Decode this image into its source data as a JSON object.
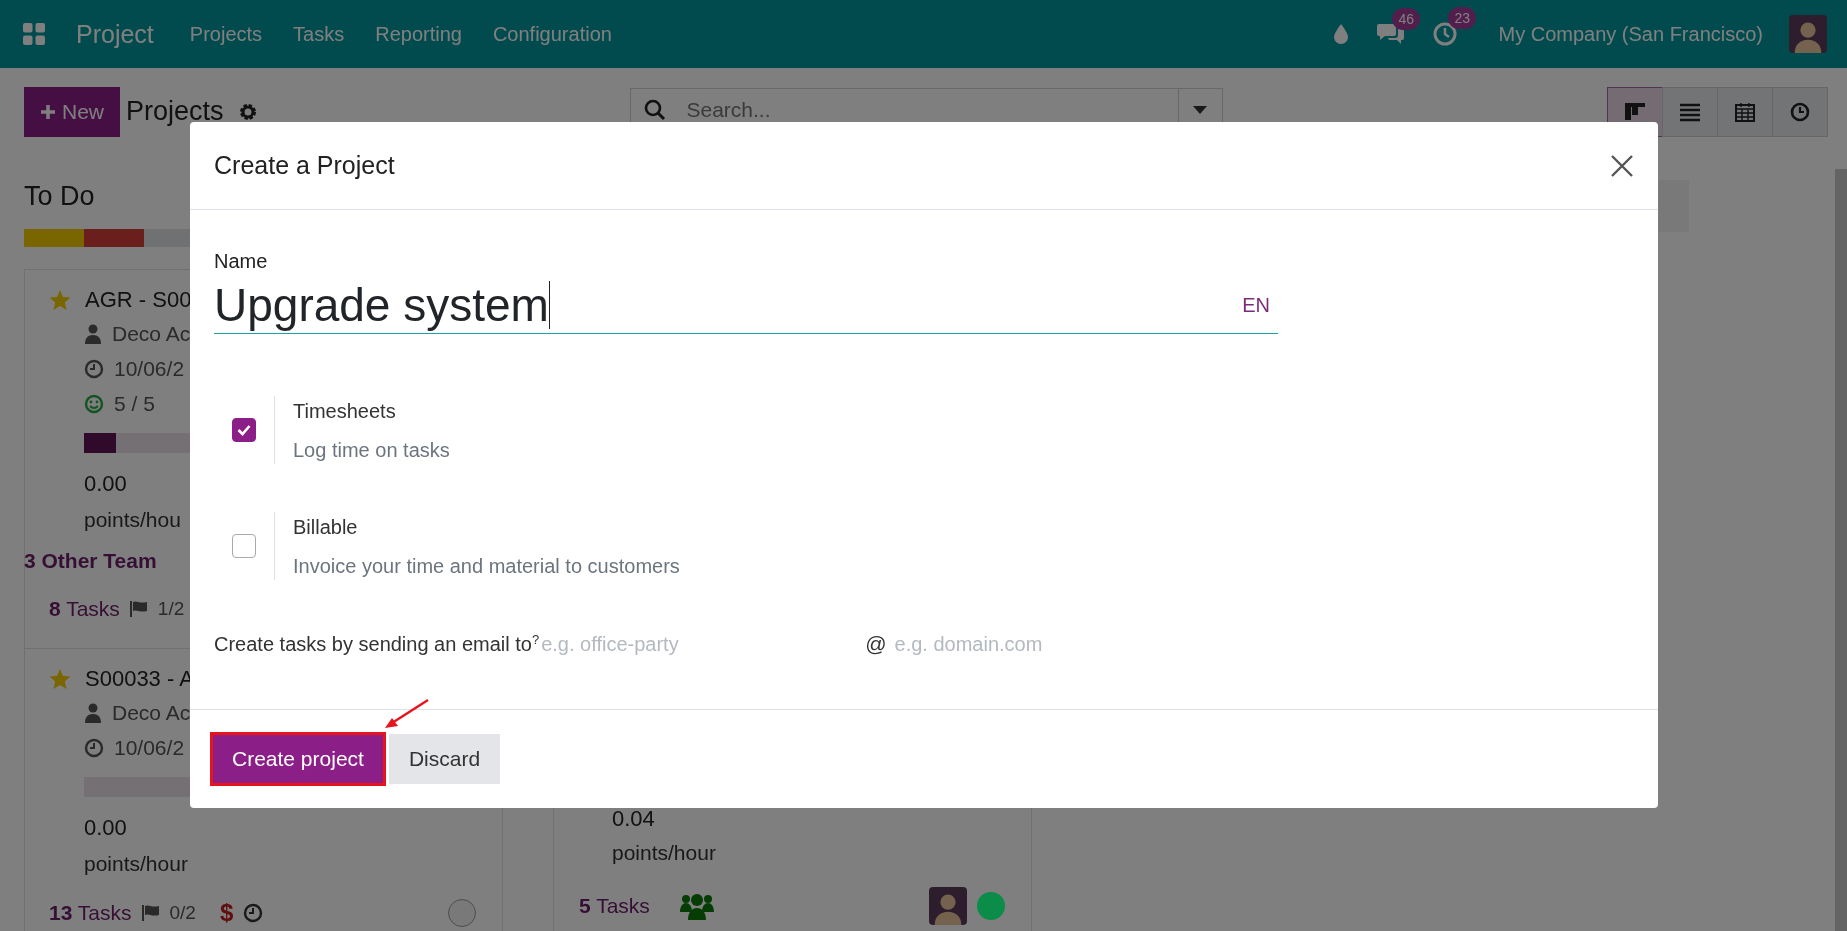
{
  "navbar": {
    "app_name": "Project",
    "menu": [
      "Projects",
      "Tasks",
      "Reporting",
      "Configuration"
    ],
    "messages_badge": "46",
    "activities_badge": "23",
    "company": "My Company (San Francisco)"
  },
  "control_panel": {
    "new_button": "New",
    "title": "Projects",
    "search": {
      "placeholder": "Search..."
    },
    "views": [
      {
        "kind": "kanban",
        "selected": true
      },
      {
        "kind": "list",
        "selected": false
      },
      {
        "kind": "calendar",
        "selected": false
      },
      {
        "kind": "activity",
        "selected": false
      }
    ]
  },
  "columns": [
    {
      "title": "To Do",
      "progress": [
        {
          "color": "#7a6600"
        },
        {
          "color": "#6b1f1d"
        },
        {
          "color": "#6f7173"
        }
      ],
      "cards": [
        {
          "kind": "full",
          "title": "AGR - S00",
          "starred": true,
          "customer": "Deco Ac",
          "date": "10/06/2",
          "rating": "5 / 5",
          "level": 0.08,
          "value": "0.00",
          "unit": "points/hou",
          "other": "3 Other Team",
          "tasks_count": "8",
          "tasks_label": "Tasks",
          "milestones": "1/2"
        },
        {
          "kind": "full",
          "title": "S00033 - A",
          "starred": true,
          "customer": "Deco Ac",
          "date": "10/06/2",
          "level": 0,
          "value": "0.00",
          "unit": "points/hour",
          "tasks_count": "13",
          "tasks_label": "Tasks",
          "milestones": "0/2",
          "currency": "$"
        }
      ]
    },
    {
      "cards": [
        {
          "kind": "bottom",
          "value": "0.04",
          "unit": "points/hour",
          "tasks_count": "5",
          "tasks_label": "Tasks",
          "color": "#0b8c48"
        }
      ]
    }
  ],
  "dialog": {
    "title": "Create a Project",
    "name_label": "Name",
    "name_value": "Upgrade system",
    "language": "EN",
    "options": [
      {
        "title": "Timesheets",
        "description": "Log time on tasks",
        "checked": true
      },
      {
        "title": "Billable",
        "description": "Invoice your time and material to customers",
        "checked": false
      }
    ],
    "email": {
      "label": "Create tasks by sending an email to",
      "help": "?",
      "alias_placeholder": "e.g. office-party",
      "at": "@",
      "domain_placeholder": "e.g. domain.com"
    },
    "buttons": [
      {
        "label": "Create project",
        "kind": "primary",
        "highlighted": true
      },
      {
        "label": "Discard",
        "kind": "secondary",
        "highlighted": false
      }
    ]
  }
}
